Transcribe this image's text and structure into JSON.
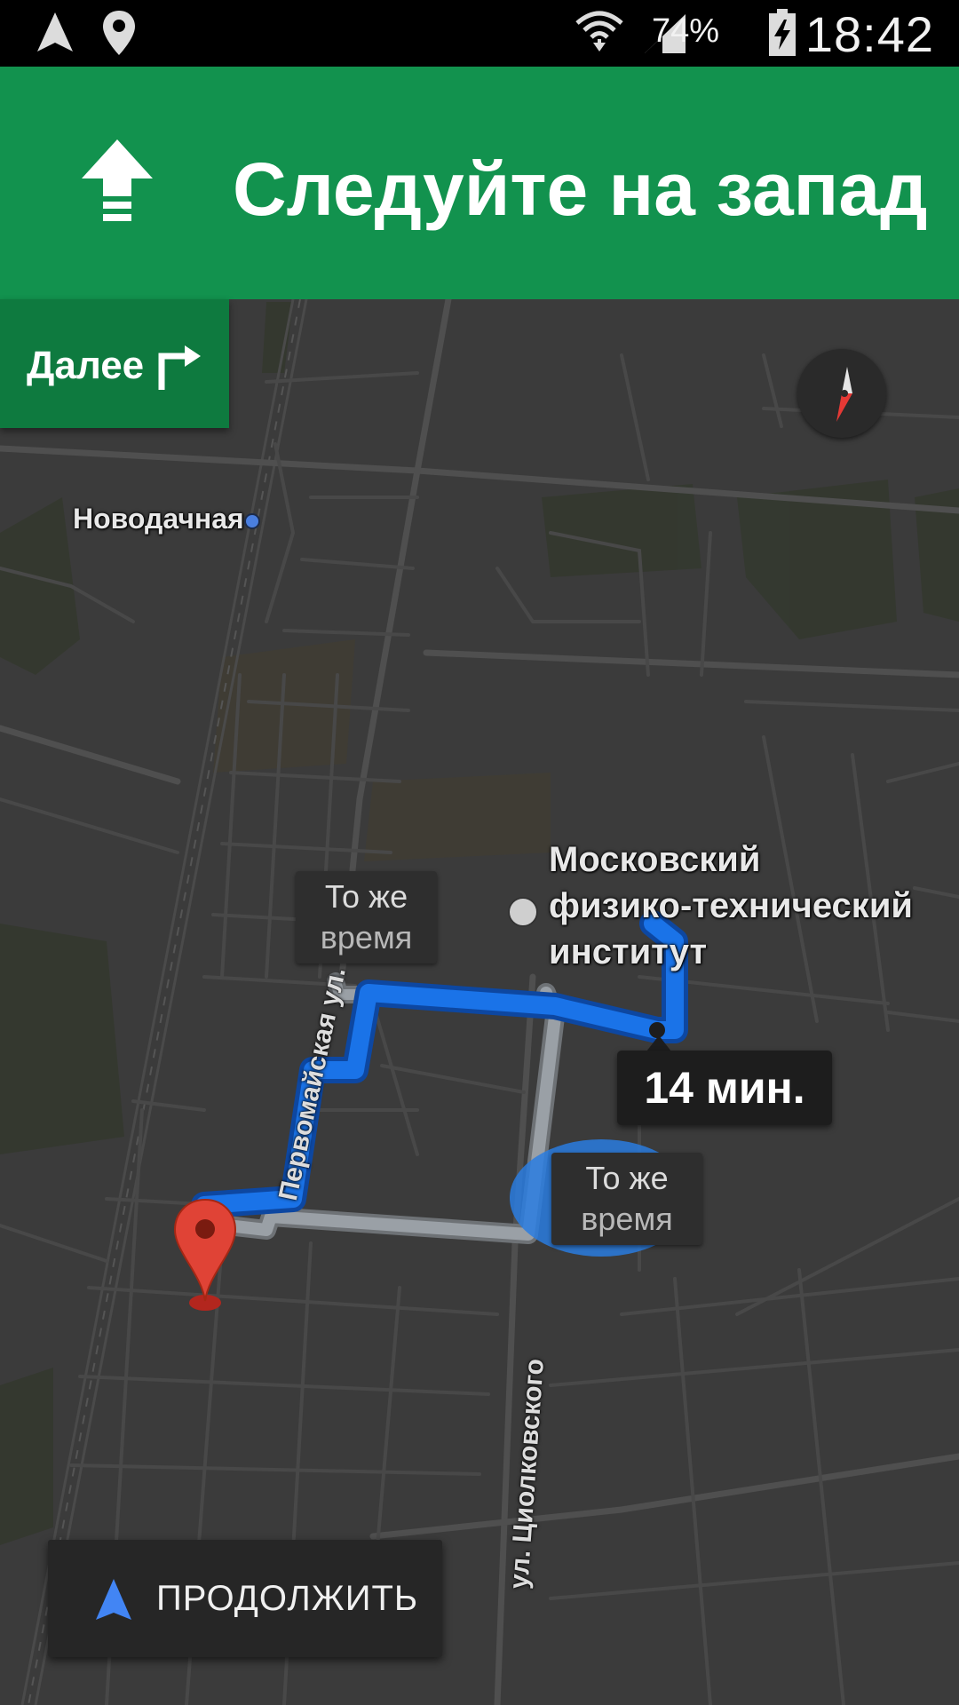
{
  "status_bar": {
    "battery_percent": "74%",
    "time": "18:42",
    "icons": [
      "navigation-arrow-icon",
      "location-pin-icon",
      "wifi-icon",
      "signal-icon",
      "battery-charging-icon"
    ]
  },
  "navigation": {
    "instruction": "Следуйте на запад",
    "maneuver_icon": "straight-arrow-icon",
    "banner_color": "#12924e"
  },
  "next_turn": {
    "label": "Далее",
    "icon": "turn-right-icon",
    "card_color": "#0e7a3f"
  },
  "map": {
    "station_name": "Новодачная",
    "poi_lines": [
      "Московский",
      "физико-технический",
      "институт"
    ],
    "streets": [
      "Первомайская ул.",
      "ул. Циолковского"
    ],
    "alt_routes": [
      {
        "line1": "То же",
        "line2": "время"
      },
      {
        "line1": "То же",
        "line2": "время"
      }
    ],
    "eta": "14 мин.",
    "route_color": "#1a73e8",
    "alt_route_color": "#9aa0a6",
    "destination_icon": "destination-pin-icon",
    "compass_icon": "compass-icon"
  },
  "continue_button": {
    "label": "ПРОДОЛЖИТЬ",
    "icon": "navigation-arrow-icon",
    "icon_color": "#4285f4"
  }
}
